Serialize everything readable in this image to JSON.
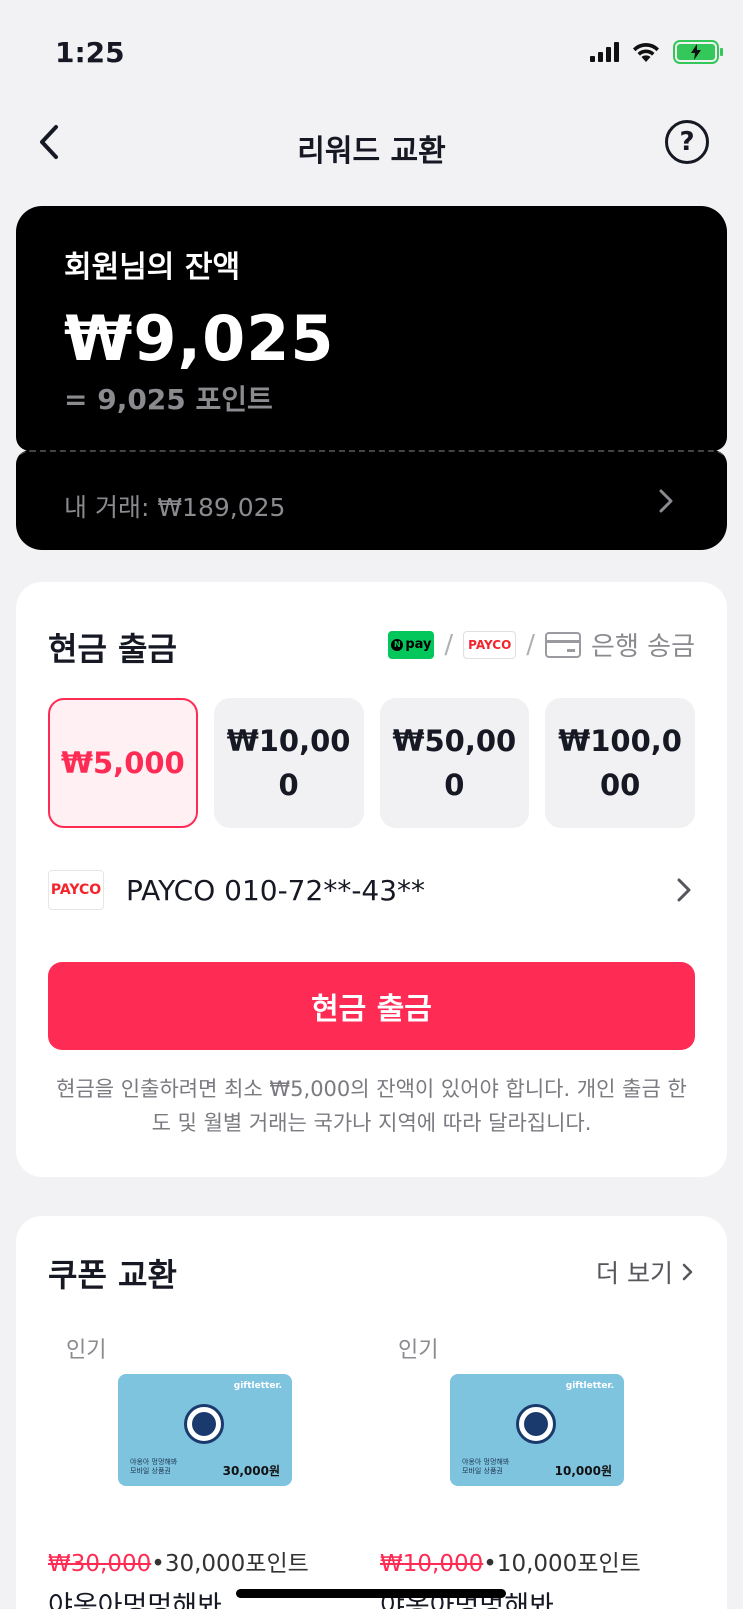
{
  "status_bar": {
    "time": "1:25"
  },
  "header": {
    "title": "리워드 교환",
    "help": "?"
  },
  "balance": {
    "label": "회원님의 잔액",
    "amount": "₩9,025",
    "points": "= 9,025 포인트",
    "transactions": "내 거래: ₩189,025"
  },
  "cash": {
    "title": "현금 출금",
    "methods": {
      "npay": "pay",
      "payco": "PAYCO",
      "slash": "/",
      "bank": "은행 송금"
    },
    "amounts": [
      {
        "label": "₩5,000",
        "selected": true
      },
      {
        "label": "₩10,000",
        "selected": false
      },
      {
        "label": "₩50,000",
        "selected": false
      },
      {
        "label": "₩100,000",
        "selected": false
      }
    ],
    "account_badge": "PAYCO",
    "account": "PAYCO 010-72**-43**",
    "button": "현금 출금",
    "note": "현금을 인출하려면 최소 ₩5,000의 잔액이 있어야 합니다. 개인 출금 한도 및 월별 거래는 국가나 지역에 따라 달라집니다."
  },
  "coupons": {
    "title": "쿠폰 교환",
    "more": "더 보기",
    "items": [
      {
        "badge": "인기",
        "card_brand": "giftletter.",
        "card_text": "야옹아 멍멍해봐 모바일 상품권",
        "card_value": "30,000원",
        "old_price": "₩30,000",
        "separator": "•",
        "points": "30,000포인트",
        "name": "야옹아멍멍해봐"
      },
      {
        "badge": "인기",
        "card_brand": "giftletter.",
        "card_text": "야옹아 멍멍해봐 모바일 상품권",
        "card_value": "10,000원",
        "old_price": "₩10,000",
        "separator": "•",
        "points": "10,000포인트",
        "name": "야옹아멍멍해봐"
      }
    ]
  },
  "colors": {
    "accent": "#fe2c55",
    "background": "#f2f2f4",
    "card": "#000000",
    "npay": "#03c75a",
    "battery": "#34c759"
  }
}
